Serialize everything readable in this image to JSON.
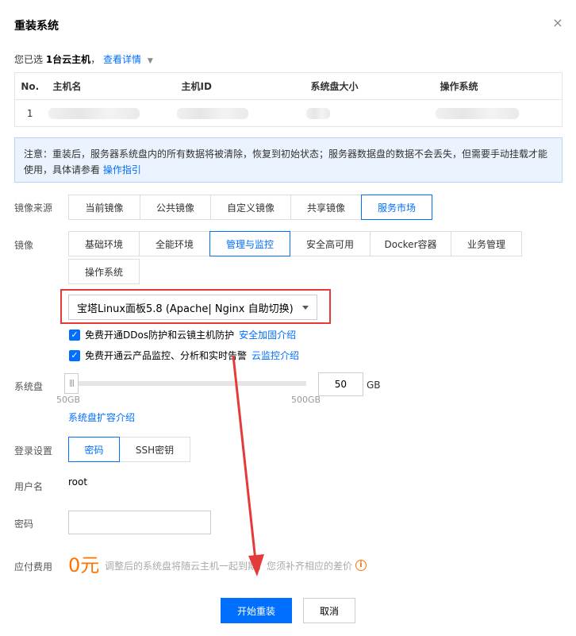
{
  "dialog": {
    "title": "重装系统",
    "close_glyph": "×"
  },
  "selection": {
    "prefix": "您已选 ",
    "count": "1台云主机",
    "suffix": "，",
    "details_link": "查看详情",
    "caret": "▼"
  },
  "table": {
    "headers": [
      "No.",
      "主机名",
      "主机ID",
      "系统盘大小",
      "操作系统"
    ],
    "rows": [
      {
        "no": "1"
      }
    ]
  },
  "notice": {
    "text": "注意：重装后，服务器系统盘内的所有数据将被清除，恢复到初始状态；服务器数据盘的数据不会丢失，但需要手动挂载才能使用，具体请参看 ",
    "link": "操作指引"
  },
  "image_source": {
    "label": "镜像来源",
    "options": [
      "当前镜像",
      "公共镜像",
      "自定义镜像",
      "共享镜像",
      "服务市场"
    ],
    "selected": "服务市场"
  },
  "image": {
    "label": "镜像",
    "categories": [
      "基础环境",
      "全能环境",
      "管理与监控",
      "安全高可用",
      "Docker容器",
      "业务管理",
      "操作系统"
    ],
    "selected": "管理与监控",
    "dropdown_value": "宝塔Linux面板5.8 (Apache| Nginx 自助切换)"
  },
  "checkboxes": [
    {
      "text": "免费开通DDos防护和云镜主机防护",
      "link": "安全加固介绍",
      "checked": true,
      "glyph": "✓"
    },
    {
      "text": "免费开通云产品监控、分析和实时告警",
      "link": "云监控介绍",
      "checked": true,
      "glyph": "✓"
    }
  ],
  "system_disk": {
    "label": "系统盘",
    "value": "50",
    "unit": "GB",
    "min_label": "50GB",
    "max_label": "500GB",
    "min": 50,
    "max": 500,
    "handle_glyph": "|||",
    "expand_link": "系统盘扩容介绍"
  },
  "login": {
    "label": "登录设置",
    "options": [
      "密码",
      "SSH密钥"
    ],
    "selected": "密码"
  },
  "username": {
    "label": "用户名",
    "value": "root"
  },
  "password": {
    "label": "密码",
    "value": ""
  },
  "fee": {
    "label": "应付费用",
    "amount": "0元",
    "desc": "调整后的系统盘将随云主机一起到期，您须补齐相应的差价",
    "info_glyph": "i"
  },
  "actions": {
    "confirm": "开始重装",
    "cancel": "取消"
  },
  "colors": {
    "accent": "#006eff",
    "annotation": "#e33a3a",
    "fee": "#ff7200"
  }
}
